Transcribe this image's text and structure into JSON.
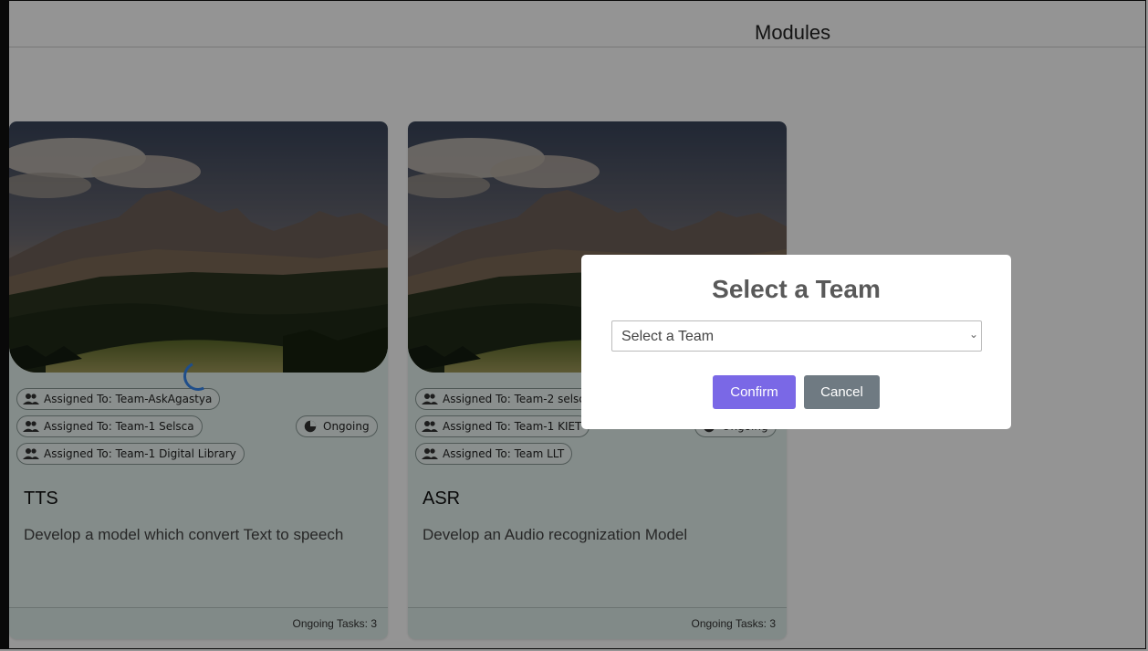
{
  "header": {
    "title": "Modules"
  },
  "cards": [
    {
      "chips": [
        "Assigned To: Team-AskAgastya",
        "Assigned To: Team-1 Selsca",
        "Assigned To: Team-1 Digital Library"
      ],
      "status": "Ongoing",
      "title": "TTS",
      "description": "Develop a model which convert Text to speech",
      "footer": "Ongoing Tasks: 3"
    },
    {
      "chips": [
        "Assigned To: Team-2 selsca",
        "Assigned To: Team-1 KIET",
        "Assigned To: Team LLT"
      ],
      "status": "Ongoing",
      "title": "ASR",
      "description": "Develop an Audio recognization Model",
      "footer": "Ongoing Tasks: 3"
    }
  ],
  "modal": {
    "title": "Select a Team",
    "select_value": "Select a Team",
    "confirm_label": "Confirm",
    "cancel_label": "Cancel"
  },
  "colors": {
    "confirm": "#7a68e6",
    "cancel": "#6f7a82",
    "card_bg": "#e4f1ee"
  }
}
